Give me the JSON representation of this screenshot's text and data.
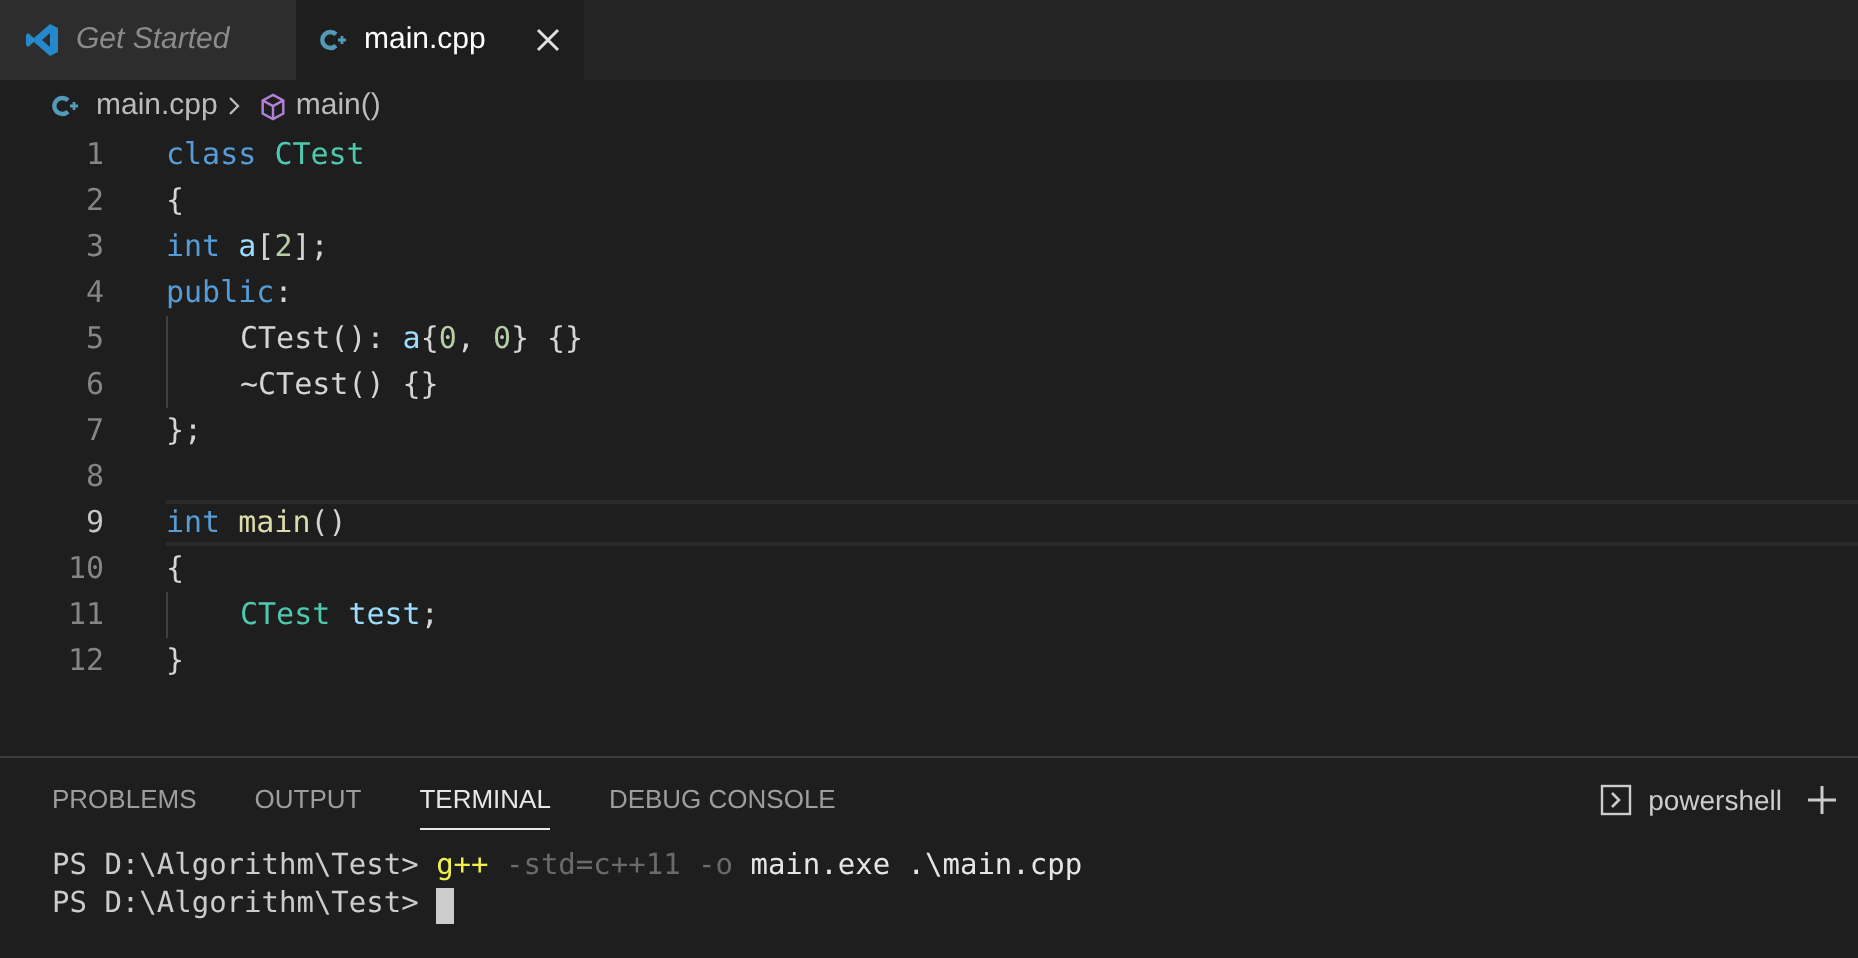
{
  "tabs": [
    {
      "label": "Get Started",
      "kind": "app",
      "selected": false,
      "preview": true
    },
    {
      "label": "main.cpp",
      "kind": "file",
      "selected": true,
      "preview": false
    }
  ],
  "breadcrumb": {
    "file": "main.cpp",
    "symbol": "main()"
  },
  "code_lines": [
    {
      "number": "1",
      "indented": false,
      "current": false,
      "tokens": [
        {
          "kind": "keyword",
          "text": "class "
        },
        {
          "kind": "type",
          "text": "CTest"
        }
      ]
    },
    {
      "number": "2",
      "indented": false,
      "current": false,
      "tokens": [
        {
          "kind": "plain",
          "text": "{"
        }
      ]
    },
    {
      "number": "3",
      "indented": false,
      "current": false,
      "tokens": [
        {
          "kind": "keyword",
          "text": "int "
        },
        {
          "kind": "var",
          "text": "a"
        },
        {
          "kind": "plain",
          "text": "["
        },
        {
          "kind": "number",
          "text": "2"
        },
        {
          "kind": "plain",
          "text": "];"
        }
      ]
    },
    {
      "number": "4",
      "indented": false,
      "current": false,
      "tokens": [
        {
          "kind": "keyword",
          "text": "public"
        },
        {
          "kind": "plain",
          "text": ":"
        }
      ]
    },
    {
      "number": "5",
      "indented": true,
      "current": false,
      "tokens": [
        {
          "kind": "plain",
          "text": "CTest(): "
        },
        {
          "kind": "var",
          "text": "a"
        },
        {
          "kind": "plain",
          "text": "{"
        },
        {
          "kind": "number",
          "text": "0"
        },
        {
          "kind": "plain",
          "text": ", "
        },
        {
          "kind": "number",
          "text": "0"
        },
        {
          "kind": "plain",
          "text": "} {}"
        }
      ]
    },
    {
      "number": "6",
      "indented": true,
      "current": false,
      "tokens": [
        {
          "kind": "plain",
          "text": "~CTest() {}"
        }
      ]
    },
    {
      "number": "7",
      "indented": false,
      "current": false,
      "tokens": [
        {
          "kind": "plain",
          "text": "};"
        }
      ]
    },
    {
      "number": "8",
      "indented": false,
      "current": false
    },
    {
      "number": "9",
      "indented": false,
      "current": true,
      "tokens": [
        {
          "kind": "keyword",
          "text": "int "
        },
        {
          "kind": "func",
          "text": "main"
        },
        {
          "kind": "plain",
          "text": "()"
        }
      ]
    },
    {
      "number": "10",
      "indented": false,
      "current": false,
      "tokens": [
        {
          "kind": "plain",
          "text": "{"
        }
      ]
    },
    {
      "number": "11",
      "indented": true,
      "current": false,
      "tokens": [
        {
          "kind": "type",
          "text": "CTest "
        },
        {
          "kind": "var",
          "text": "test"
        },
        {
          "kind": "plain",
          "text": ";"
        }
      ]
    },
    {
      "number": "12",
      "indented": false,
      "current": false,
      "tokens": [
        {
          "kind": "plain",
          "text": "}"
        }
      ]
    }
  ],
  "panel_tabs": [
    {
      "label": "PROBLEMS",
      "selected": false
    },
    {
      "label": "OUTPUT",
      "selected": false
    },
    {
      "label": "TERMINAL",
      "selected": true
    },
    {
      "label": "DEBUG CONSOLE",
      "selected": false
    }
  ],
  "terminal_name": "powershell",
  "terminal_lines": [
    {
      "cursor": false,
      "tokens": [
        {
          "kind": "prompt",
          "text": "PS D:\\Algorithm\\Test> "
        },
        {
          "kind": "command",
          "text": "g++"
        },
        {
          "kind": "arg",
          "text": " -std=c++11 -o"
        },
        {
          "kind": "plain",
          "text": " main.exe .\\main.cpp"
        }
      ]
    },
    {
      "cursor": true,
      "tokens": [
        {
          "kind": "prompt",
          "text": "PS D:\\Algorithm\\Test> "
        }
      ]
    }
  ]
}
